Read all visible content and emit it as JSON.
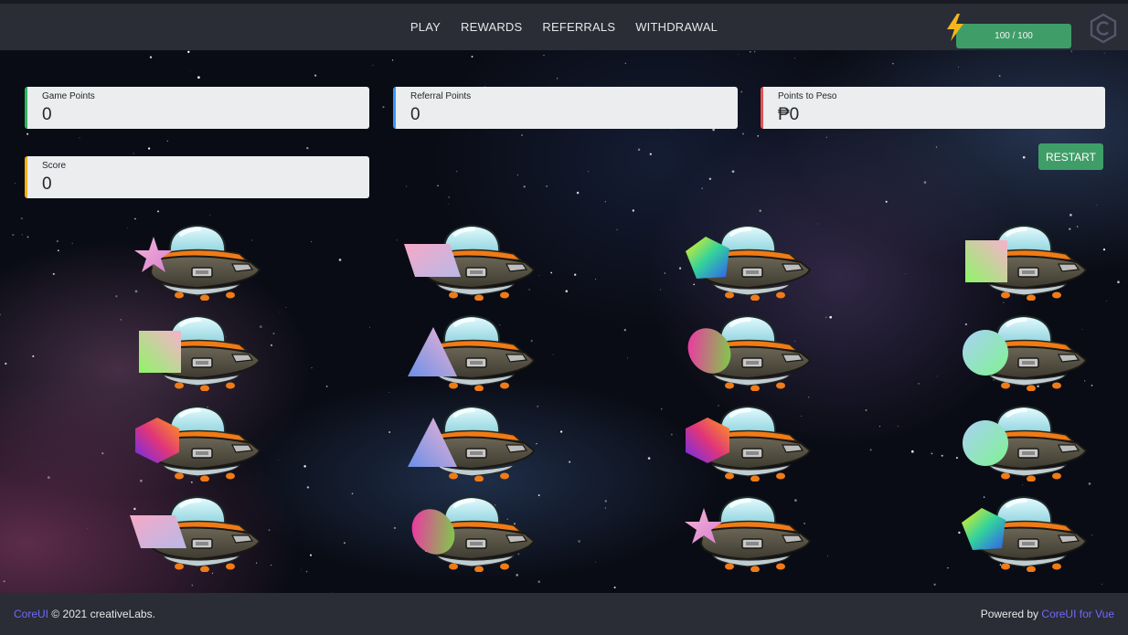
{
  "nav": {
    "items": [
      {
        "label": "PLAY"
      },
      {
        "label": "REWARDS"
      },
      {
        "label": "REFERRALS"
      },
      {
        "label": "WITHDRAWAL"
      }
    ]
  },
  "energy": {
    "text": "100 / 100",
    "current": 100,
    "max": 100,
    "color": "#3f9e68"
  },
  "stats": {
    "game_points": {
      "label": "Game Points",
      "value": "0",
      "accent": "#2eb85c"
    },
    "referral_points": {
      "label": "Referral Points",
      "value": "0",
      "accent": "#39f"
    },
    "points_to_peso": {
      "label": "Points to Peso",
      "value": "₱0",
      "accent": "#e55353"
    },
    "score": {
      "label": "Score",
      "value": "0",
      "accent": "#f9b115"
    }
  },
  "restart_label": "RESTART",
  "grid": {
    "rows": [
      [
        "star",
        "parallelogram",
        "pentagon",
        "square"
      ],
      [
        "square",
        "triangle",
        "ellipse",
        "circle"
      ],
      [
        "hexagon",
        "triangle",
        "hexagon",
        "circle"
      ],
      [
        "parallelogram",
        "ellipse",
        "star",
        "pentagon"
      ]
    ]
  },
  "footer": {
    "brand": "CoreUI",
    "copyright": "© 2021 creativeLabs.",
    "powered_prefix": "Powered by",
    "powered_link": "CoreUI for Vue"
  }
}
